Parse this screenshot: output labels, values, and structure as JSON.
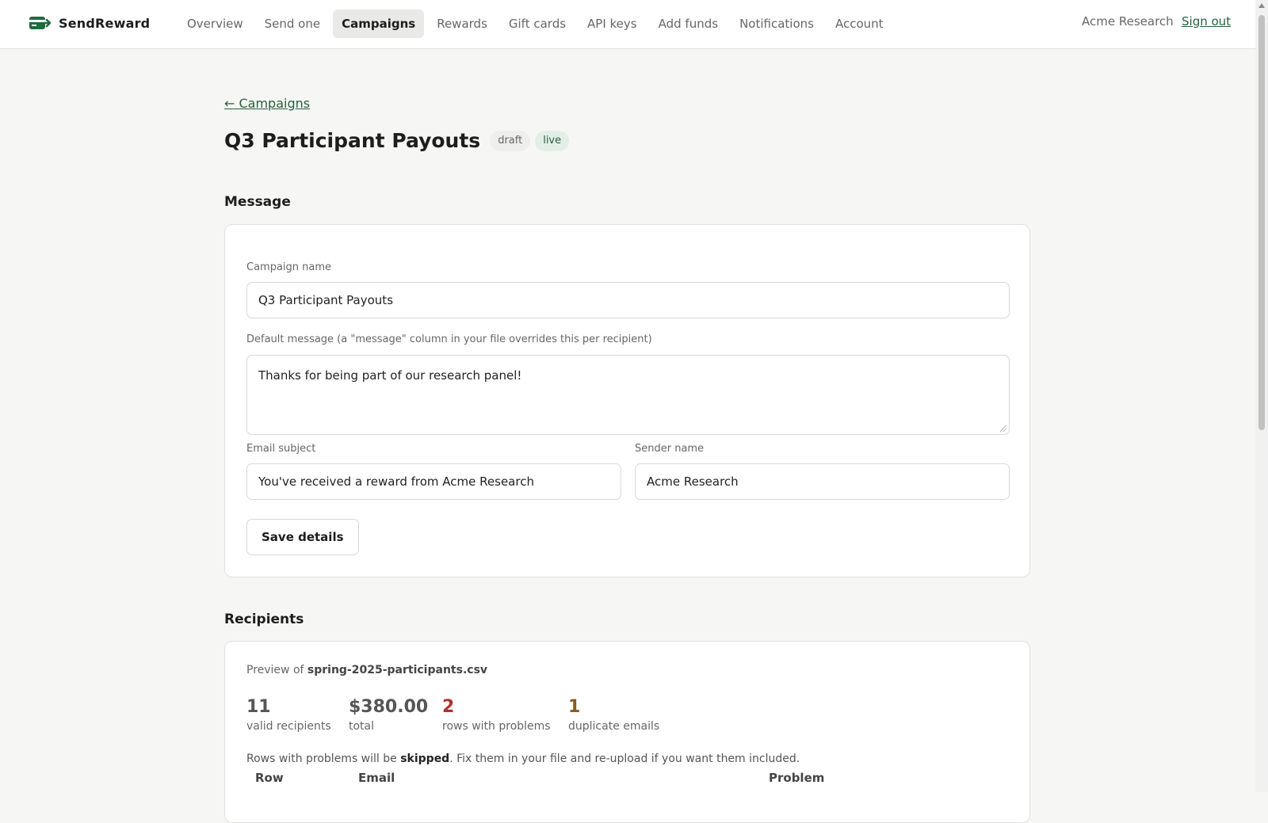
{
  "app": {
    "name": "SendReward",
    "logo_icon": "send-card-icon",
    "brand_color": "#1f6b3f"
  },
  "nav": {
    "items": [
      {
        "label": "Overview"
      },
      {
        "label": "Send one"
      },
      {
        "label": "Campaigns",
        "active": true
      },
      {
        "label": "Rewards"
      },
      {
        "label": "Gift cards"
      },
      {
        "label": "API keys"
      },
      {
        "label": "Add funds"
      },
      {
        "label": "Notifications"
      },
      {
        "label": "Account"
      }
    ],
    "org": "Acme Research",
    "signout": "Sign out"
  },
  "page": {
    "back_link": "← Campaigns",
    "title": "Q3 Participant Payouts",
    "badges": {
      "draft": "draft",
      "live": "live"
    }
  },
  "message": {
    "heading": "Message",
    "campaign_name_label": "Campaign name",
    "campaign_name_value": "Q3 Participant Payouts",
    "default_message_label": "Default message (a \"message\" column in your file overrides this per recipient)",
    "default_message_value": "Thanks for being part of our research panel!",
    "email_subject_label": "Email subject",
    "email_subject_value": "You've received a reward from Acme Research",
    "sender_name_label": "Sender name",
    "sender_name_value": "Acme Research",
    "save_button": "Save details"
  },
  "recipients": {
    "heading": "Recipients",
    "preview_prefix": "Preview of ",
    "file_name": "spring-2025-participants.csv",
    "stats": {
      "valid_value": "11",
      "valid_label": "valid recipients",
      "total_value": "$380.00",
      "total_label": "total",
      "problems_value": "2",
      "problems_label": "rows with problems",
      "dupes_value": "1",
      "dupes_label": "duplicate emails"
    },
    "note_prefix": "Rows with problems will be ",
    "note_bold": "skipped",
    "note_suffix": ". Fix them in your file and re-upload if you want them included.",
    "columns": {
      "row": "Row",
      "email": "Email",
      "problem": "Problem"
    }
  },
  "colors": {
    "problem": "#b0302a",
    "duplicate": "#8a5a1a",
    "link": "#2a5f3d"
  }
}
